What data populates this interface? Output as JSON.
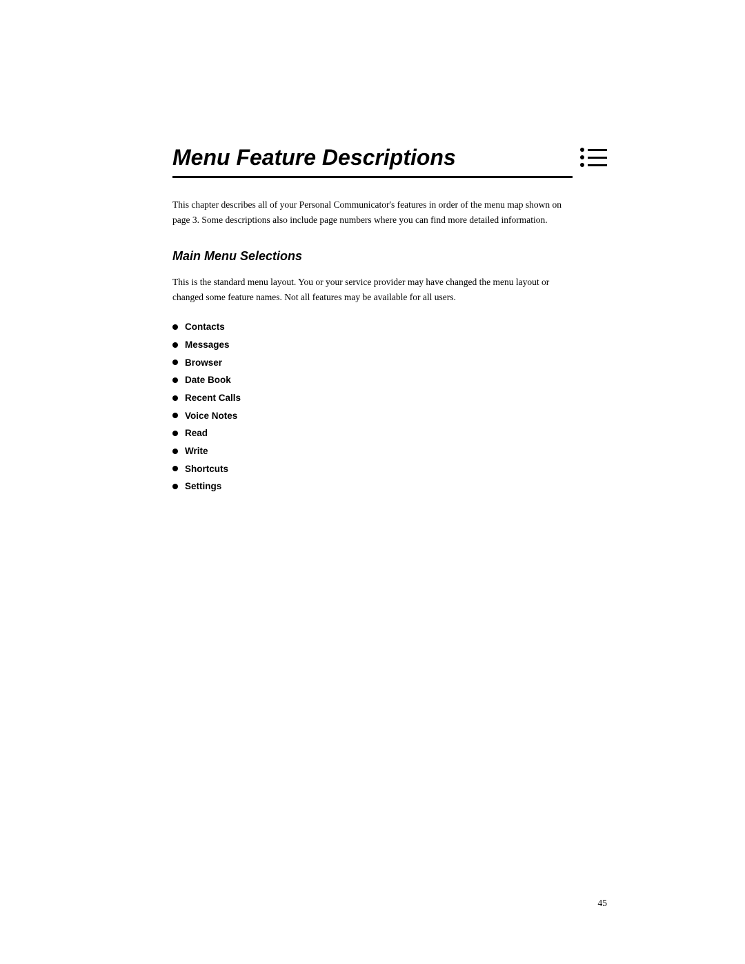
{
  "page": {
    "background": "#ffffff",
    "page_number": "45"
  },
  "chapter": {
    "title": "Menu Feature Descriptions",
    "intro": "This chapter describes all of your Personal Communicator's features in order of the menu map shown on page 3. Some descriptions also include page numbers where you can find more detailed information."
  },
  "section": {
    "title": "Main Menu Selections",
    "description": "This is the standard menu layout. You or your service provider may have changed the menu layout or changed some feature names. Not all features may be available for all users.",
    "menu_items": [
      "Contacts",
      "Messages",
      "Browser",
      "Date Book",
      "Recent Calls",
      "Voice Notes",
      "Read",
      "Write",
      "Shortcuts",
      "Settings"
    ]
  },
  "icon": {
    "name": "chapter-list-icon",
    "description": "bullet list decorative icon"
  }
}
